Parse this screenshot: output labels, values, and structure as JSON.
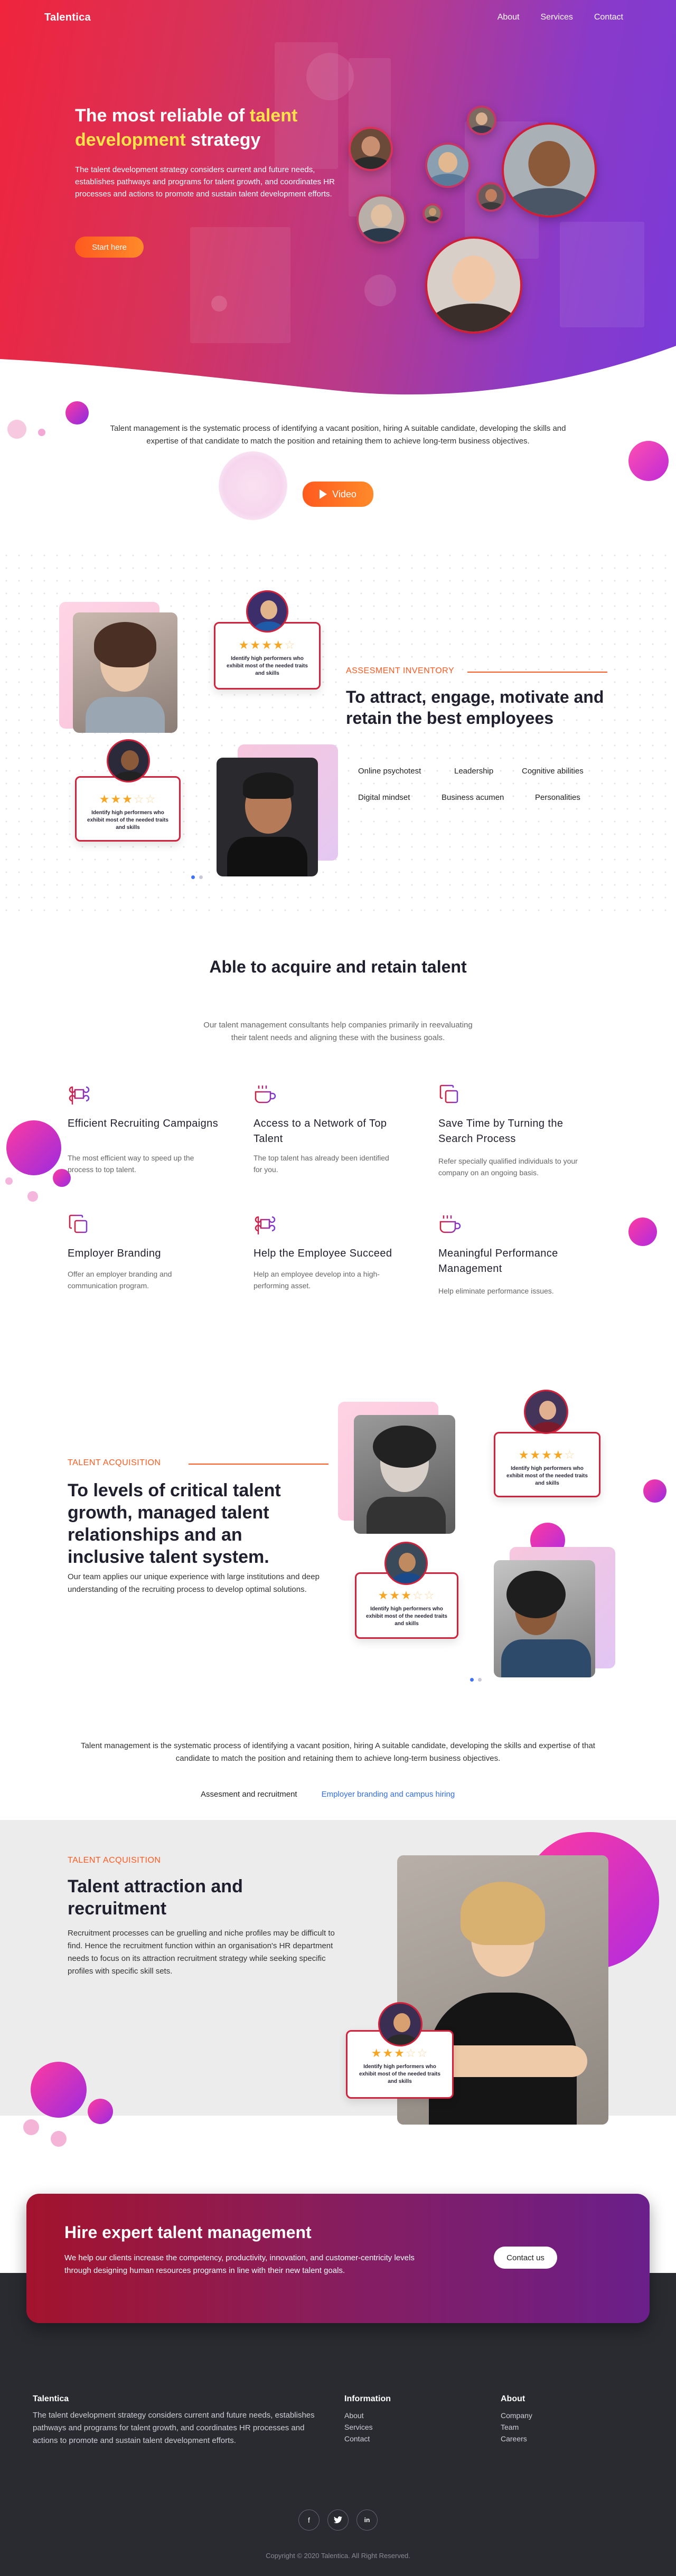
{
  "nav": {
    "brand": "Talentica",
    "links": [
      "About",
      "Services",
      "Contact"
    ]
  },
  "hero": {
    "title_pre": "The most reliable of ",
    "title_highlight_1": "talent",
    "title_highlight_2": "development",
    "title_post": " strategy",
    "text": "The talent development strategy considers current and future needs, establishes pathways and programs for talent growth, and coordinates HR processes and actions to promote and sustain talent development efforts.",
    "cta_label": "Start here"
  },
  "intro": {
    "text": "Talent management is the systematic process of identifying a vacant position, hiring A suitable candidate, developing the skills and expertise of that candidate to match the position and retaining them to achieve long-term business objectives.",
    "video_label": "Video"
  },
  "review_card_text": "Identify high performers who exhibit most of the needed traits and skills",
  "inventory": {
    "kicker": "ASSESMENT INVENTORY",
    "title": "To attract, engage, motivate and retain the best employees",
    "tags_row1": [
      "Online psychotest",
      "Leadership",
      "Cognitive abilities"
    ],
    "tags_row2": [
      "Digital mindset",
      "Business acumen",
      "Personalities"
    ]
  },
  "acquire": {
    "title": "Able to acquire and retain talent",
    "subtitle": "Our talent management consultants help companies primarily in reevaluating their talent needs and aligning these with the business goals.",
    "features": [
      {
        "title": "Efficient Recruiting Campaigns",
        "desc": "The most efficient way to speed up the process to top talent."
      },
      {
        "title": "Access to a Network of Top Talent",
        "desc": "The top talent has already been identified for you."
      },
      {
        "title": "Save Time by Turning the Search Process",
        "desc": "Refer specially qualified individuals to your company on an ongoing basis."
      },
      {
        "title": "Employer Branding",
        "desc": "Offer an employer branding and communication program."
      },
      {
        "title": "Help the Employee Succeed",
        "desc": "Help an employee develop into a high-performing asset."
      },
      {
        "title": "Meaningful Performance Management",
        "desc": "Help eliminate performance issues."
      }
    ]
  },
  "acquisition": {
    "kicker": "TALENT ACQUISITION",
    "title": "To levels of critical talent growth, managed talent relationships and an inclusive talent system.",
    "text": "Our team applies our unique experience with large institutions and deep understanding of the recruiting process to develop optimal solutions."
  },
  "tabs_intro": "Talent management is the systematic process of identifying a vacant position, hiring A suitable candidate, developing the skills and expertise of that candidate to match the position and retaining them to achieve long-term business objectives.",
  "tabs": [
    "Assesment and recruitment",
    "Employer branding and campus hiring"
  ],
  "attraction": {
    "kicker": "TALENT ACQUISITION",
    "title": "Talent attraction and recruitment",
    "text": "Recruitment processes can be gruelling and niche profiles may be difficult to find. Hence the recruitment function within an organisation's HR department needs to focus on its attraction recruitment strategy while seeking specific profiles with specific skill sets."
  },
  "cta": {
    "title": "Hire expert talent management",
    "text": "We help our clients increase the competency, productivity, innovation, and customer-centricity levels through designing human resources programs in line with their new talent goals.",
    "button": "Contact us"
  },
  "footer": {
    "brand": "Talentica",
    "text": "The talent development strategy considers current and future needs, establishes pathways and programs for talent growth, and coordinates HR processes and actions to promote and sustain talent development efforts.",
    "info_title": "Information",
    "info_links": [
      "About",
      "Services",
      "Contact"
    ],
    "about_title": "About",
    "about_links": [
      "Company",
      "Team",
      "Careers"
    ],
    "social": [
      "facebook-icon",
      "twitter-icon",
      "linkedin-icon"
    ],
    "copyright": "Copyright © 2020 Talentica. All Right Reserved."
  },
  "colors": {
    "accent_orange": "#ff5a1f",
    "accent_red": "#d3213c",
    "accent_purple": "#7a3ad8",
    "star": "#f6a623",
    "footer_bg": "#2a2b31"
  }
}
